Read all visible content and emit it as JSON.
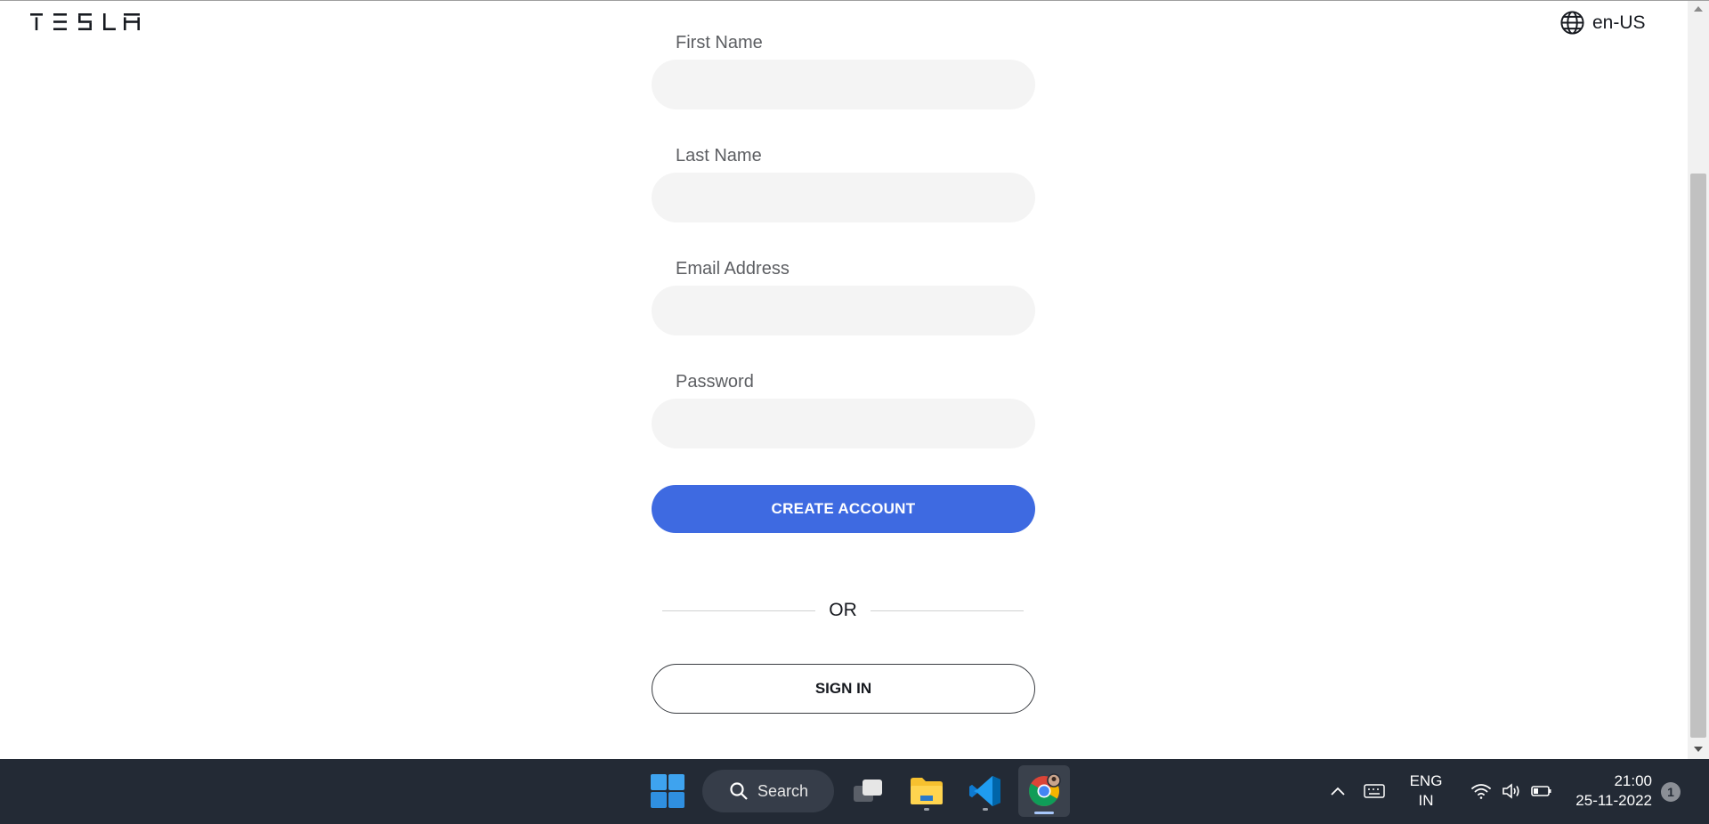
{
  "header": {
    "logo_text": "TESLA",
    "locale_label": "en-US",
    "locale_icon": "globe-icon"
  },
  "form": {
    "fields": [
      {
        "label": "First Name",
        "value": "",
        "type": "text"
      },
      {
        "label": "Last Name",
        "value": "",
        "type": "text"
      },
      {
        "label": "Email Address",
        "value": "",
        "type": "email"
      },
      {
        "label": "Password",
        "value": "",
        "type": "password"
      }
    ],
    "create_account_label": "CREATE ACCOUNT",
    "divider_text": "OR",
    "sign_in_label": "SIGN IN"
  },
  "colors": {
    "primary_button": "#3e6ae1",
    "input_background": "#f4f4f4",
    "taskbar_background": "#232a35"
  },
  "taskbar": {
    "apps": [
      "start-icon",
      "search",
      "task-view-icon",
      "file-explorer-icon",
      "vscode-icon",
      "chrome-icon"
    ],
    "search_label": "Search",
    "language_line1": "ENG",
    "language_line2": "IN",
    "time": "21:00",
    "date": "25-11-2022",
    "notification_count": "1"
  }
}
